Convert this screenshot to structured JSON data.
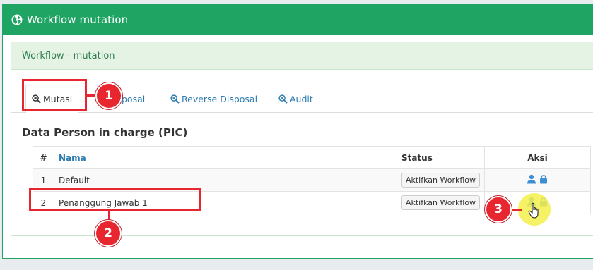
{
  "header": {
    "title": "Workflow mutation",
    "icon": "globe-icon"
  },
  "panel": {
    "title": "Workflow - mutation"
  },
  "tabs": [
    {
      "label": "Mutasi",
      "icon": "zoom-in-icon",
      "active": true
    },
    {
      "label": "posal",
      "icon": "zoom-in-icon",
      "active": false
    },
    {
      "label": "Reverse Disposal",
      "icon": "zoom-in-icon",
      "active": false
    },
    {
      "label": "Audit",
      "icon": "zoom-in-icon",
      "active": false
    }
  ],
  "section": {
    "title": "Data Person in charge (PIC)"
  },
  "table": {
    "headers": {
      "num": "#",
      "nama": "Nama",
      "status": "Status",
      "aksi": "Aksi"
    },
    "rows": [
      {
        "num": "1",
        "nama": "Default",
        "status_button": "Aktifkan Workflow"
      },
      {
        "num": "2",
        "nama": "Penanggung Jawab 1",
        "status_button": "Aktifkan Workflow"
      }
    ]
  },
  "annotations": {
    "badge1": "1",
    "badge2": "2",
    "badge3": "3"
  },
  "colors": {
    "header_bg": "#1fa464",
    "panel_head_bg": "#e4f3e4",
    "link": "#2a7ab0",
    "annotation_red": "#e8262f",
    "highlight": "#f4f04a",
    "icon_blue": "#3d8fd1"
  }
}
